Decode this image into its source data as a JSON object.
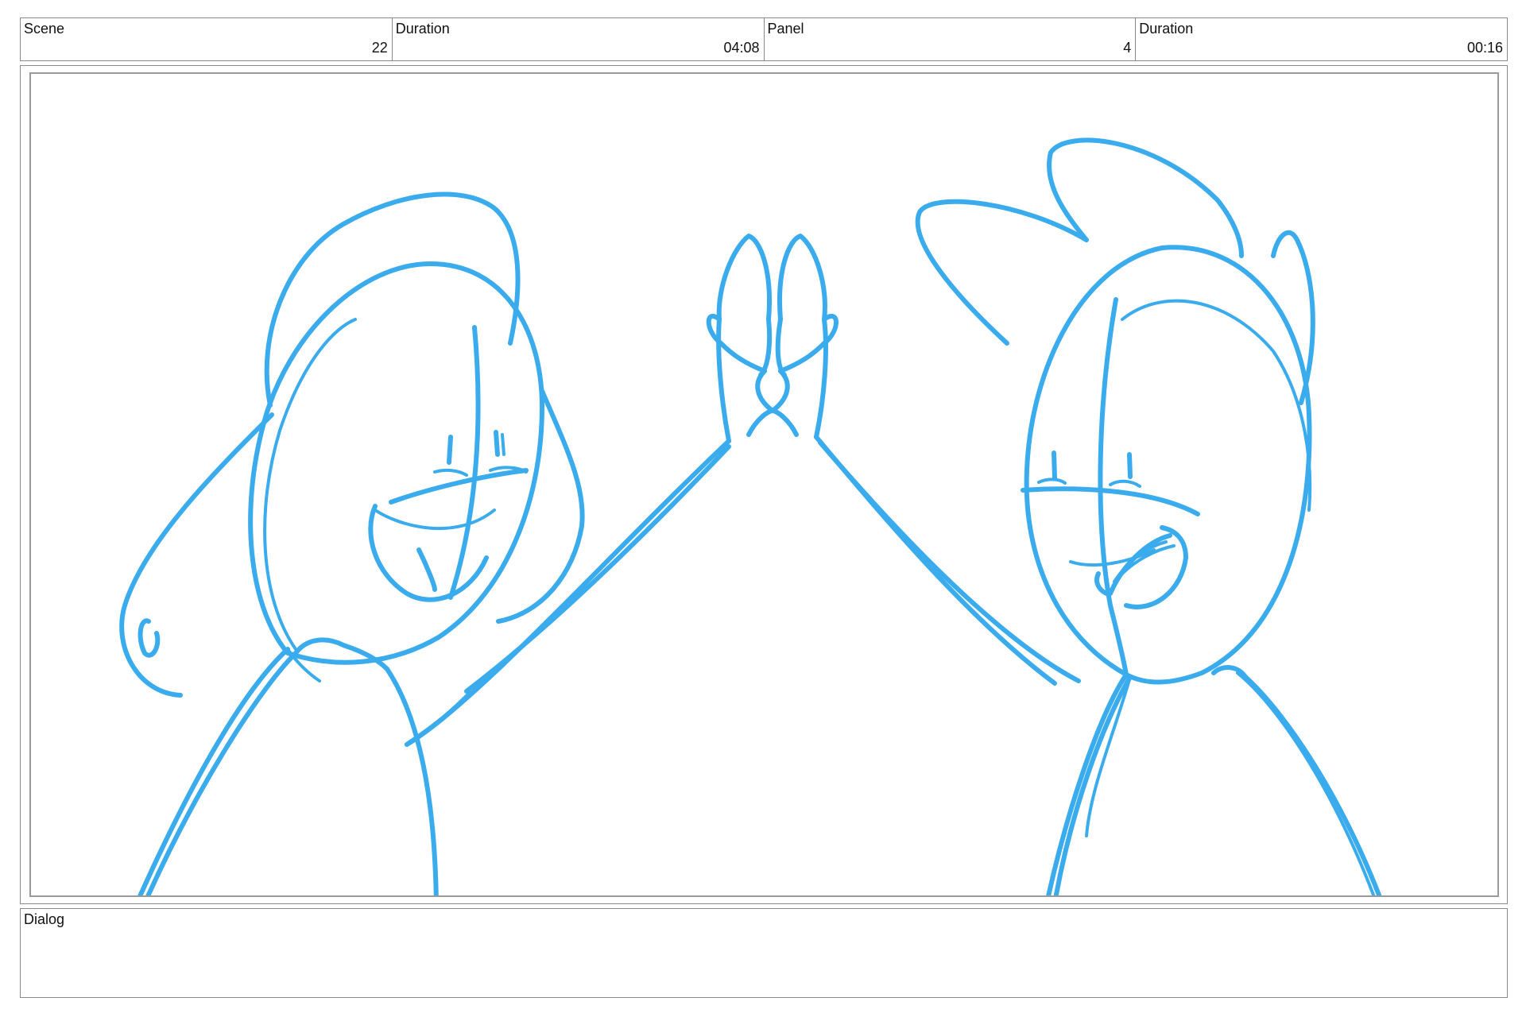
{
  "header": {
    "scene_label": "Scene",
    "scene_value": "22",
    "scene_duration_label": "Duration",
    "scene_duration_value": "04:08",
    "panel_label": "Panel",
    "panel_value": "4",
    "panel_duration_label": "Duration",
    "panel_duration_value": "00:16"
  },
  "dialog": {
    "label": "Dialog",
    "text": ""
  },
  "drawing": {
    "description_icon": "high-five-sketch",
    "stroke_color": "#3aabec"
  }
}
